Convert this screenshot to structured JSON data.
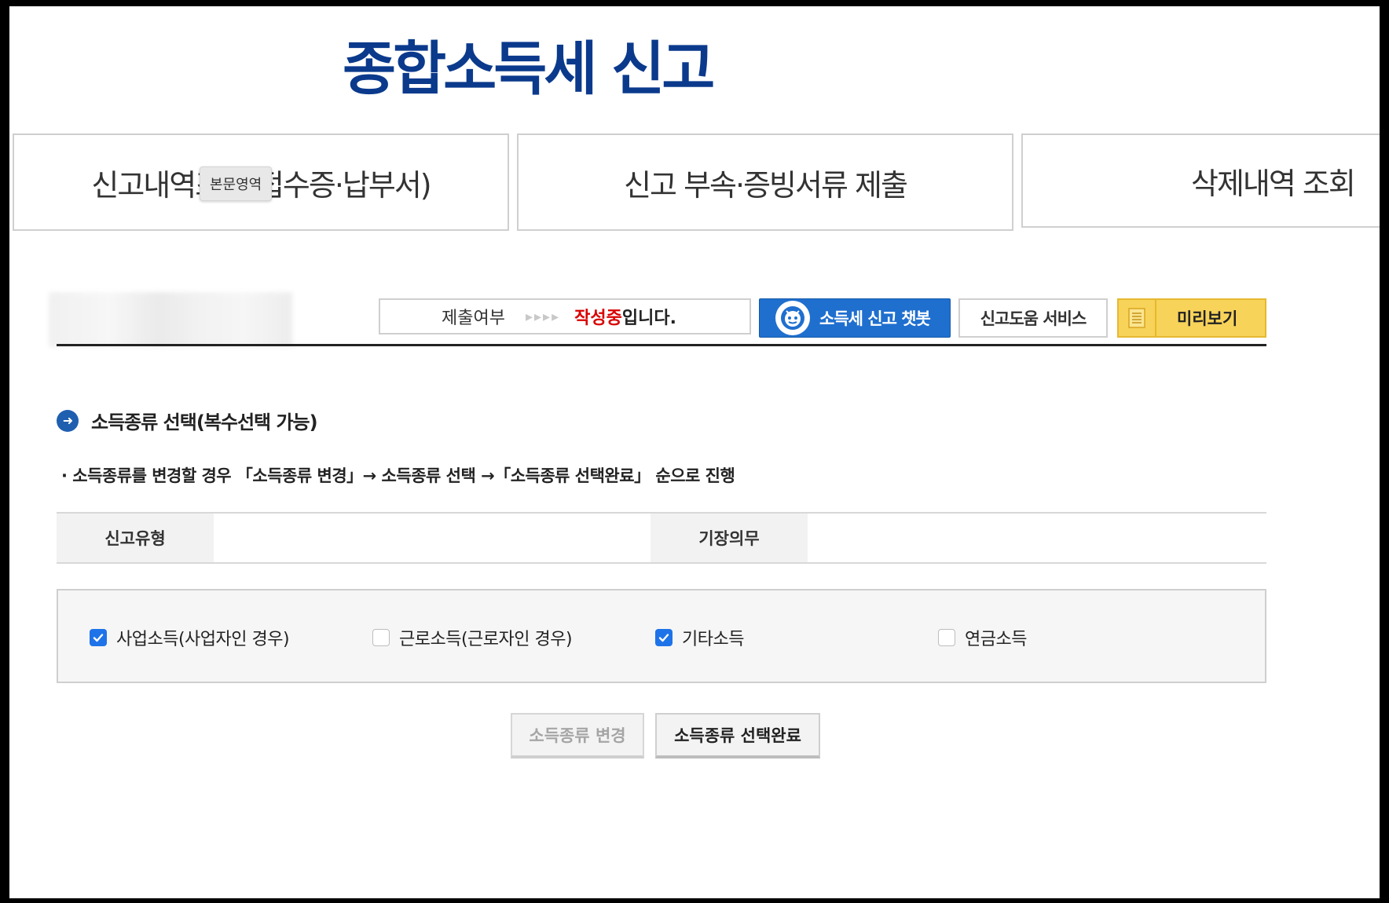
{
  "page": {
    "title": "종합소득세 신고"
  },
  "topnav": {
    "items": [
      {
        "label": "신고내역조회(접수증·납부서)"
      },
      {
        "label": "신고 부속·증빙서류 제출"
      },
      {
        "label": "삭제내역 조회"
      }
    ],
    "tooltip": "본문영역"
  },
  "status": {
    "label": "제출여부",
    "arrows": "▸▸▸▸",
    "value": "작성중",
    "suffix": "입니다.",
    "value_color": "#d90000"
  },
  "toolbar": {
    "chatbot_label": "소득세 신고 챗봇",
    "help_label": "신고도움 서비스",
    "preview_label": "미리보기"
  },
  "section": {
    "title": "소득종류 선택(복수선택 가능)",
    "note": "· 소득종류를 변경할 경우 「소득종류 변경」→ 소득종류 선택 →「소득종류 선택완료」 순으로 진행"
  },
  "info_table": {
    "report_type_label": "신고유형",
    "report_type_value": "",
    "bookkeeping_label": "기장의무",
    "bookkeeping_value": ""
  },
  "income_types": [
    {
      "label": "사업소득(사업자인 경우)",
      "checked": true
    },
    {
      "label": "근로소득(근로자인 경우)",
      "checked": false
    },
    {
      "label": "기타소득",
      "checked": true
    },
    {
      "label": "연금소득",
      "checked": false
    }
  ],
  "actions": {
    "change_label": "소득종류 변경",
    "complete_label": "소득종류 선택완료"
  },
  "colors": {
    "title": "#0b3a8c",
    "chatbot_bg": "#1f6fcf",
    "preview_bg": "#f7d35a",
    "checkbox_on": "#1e73e8"
  }
}
